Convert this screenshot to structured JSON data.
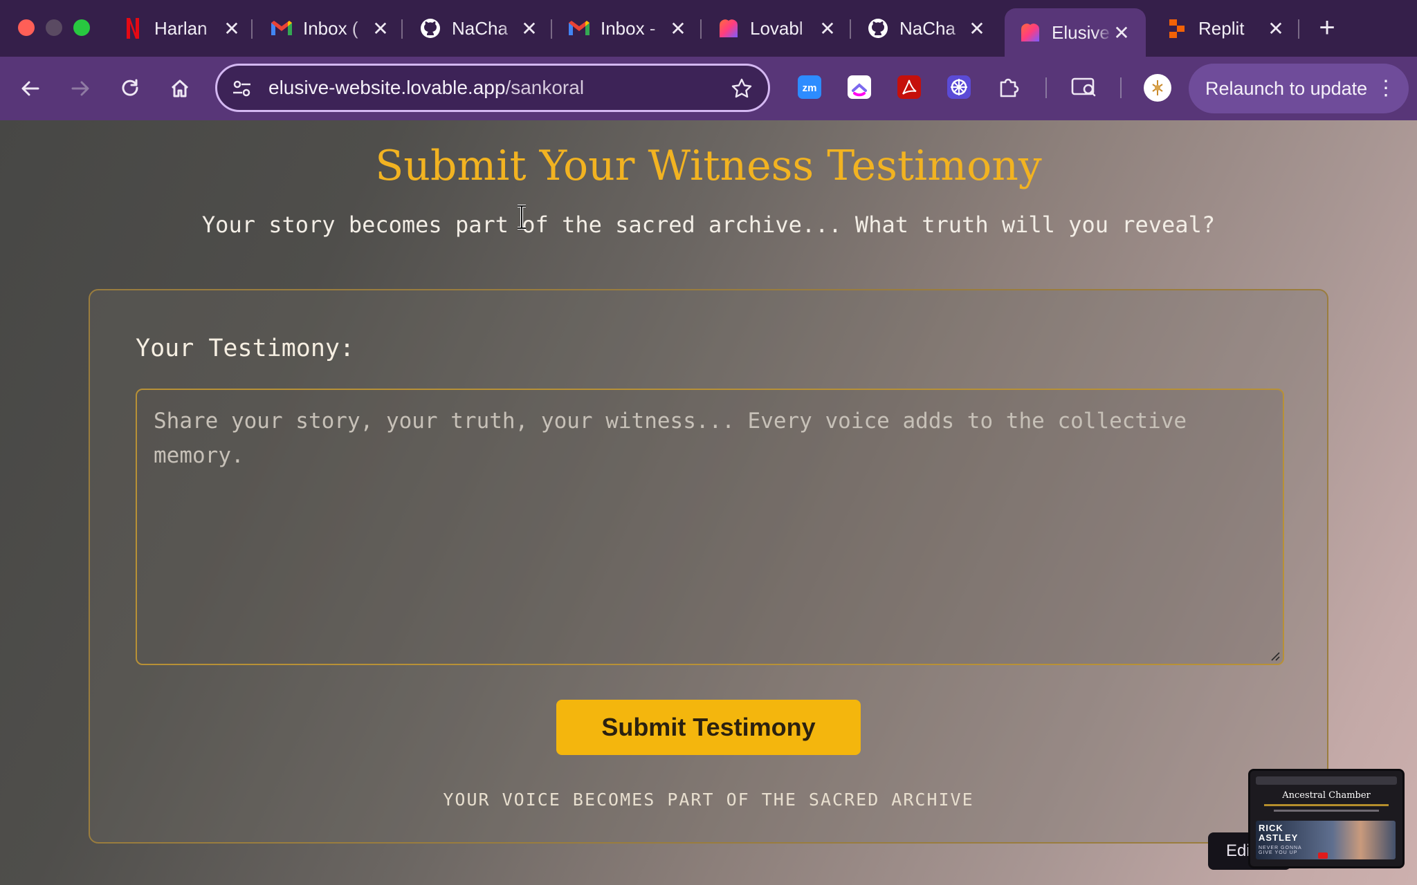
{
  "browser": {
    "tabs": [
      {
        "label": "Harlan",
        "icon": "netflix-icon"
      },
      {
        "label": "Inbox (",
        "icon": "gmail-icon"
      },
      {
        "label": "NaCha",
        "icon": "github-icon"
      },
      {
        "label": "Inbox -",
        "icon": "gmail-icon"
      },
      {
        "label": "Lovabl",
        "icon": "lovable-icon"
      },
      {
        "label": "NaCha",
        "icon": "github-icon"
      },
      {
        "label": "Elusive",
        "icon": "lovable-icon",
        "active": true
      },
      {
        "label": "Replit",
        "icon": "replit-icon"
      }
    ],
    "close_glyph": "✕",
    "new_tab_glyph": "+",
    "url_host": "elusive-website.lovable.app",
    "url_path": "/sankoral",
    "relaunch_label": "Relaunch to update",
    "relaunch_dots": "⋮",
    "extensions": [
      "zoom-icon",
      "clickup-icon",
      "acrobat-icon",
      "perplexity-icon",
      "puzzle-icon"
    ],
    "colors": {
      "chrome": "#351f4a",
      "toolbar": "#583678",
      "accent": "#f2b321"
    }
  },
  "page": {
    "title": "Submit Your Witness Testimony",
    "subtitle": "Your story becomes part of the sacred archive... What truth will you reveal?",
    "form": {
      "label": "Your Testimony:",
      "placeholder": "Share your story, your truth, your witness... Every voice adds to the collective memory.",
      "value": "",
      "submit_label": "Submit Testimony",
      "footnote": "YOUR VOICE BECOMES PART OF THE SACRED ARCHIVE"
    }
  },
  "overlay": {
    "edit_label": "Edi",
    "pip_title": "Ancestral Chamber",
    "pip_video_title": "RICK\nASTLEY",
    "pip_video_sub": "NEVER GONNA\nGIVE YOU UP"
  }
}
